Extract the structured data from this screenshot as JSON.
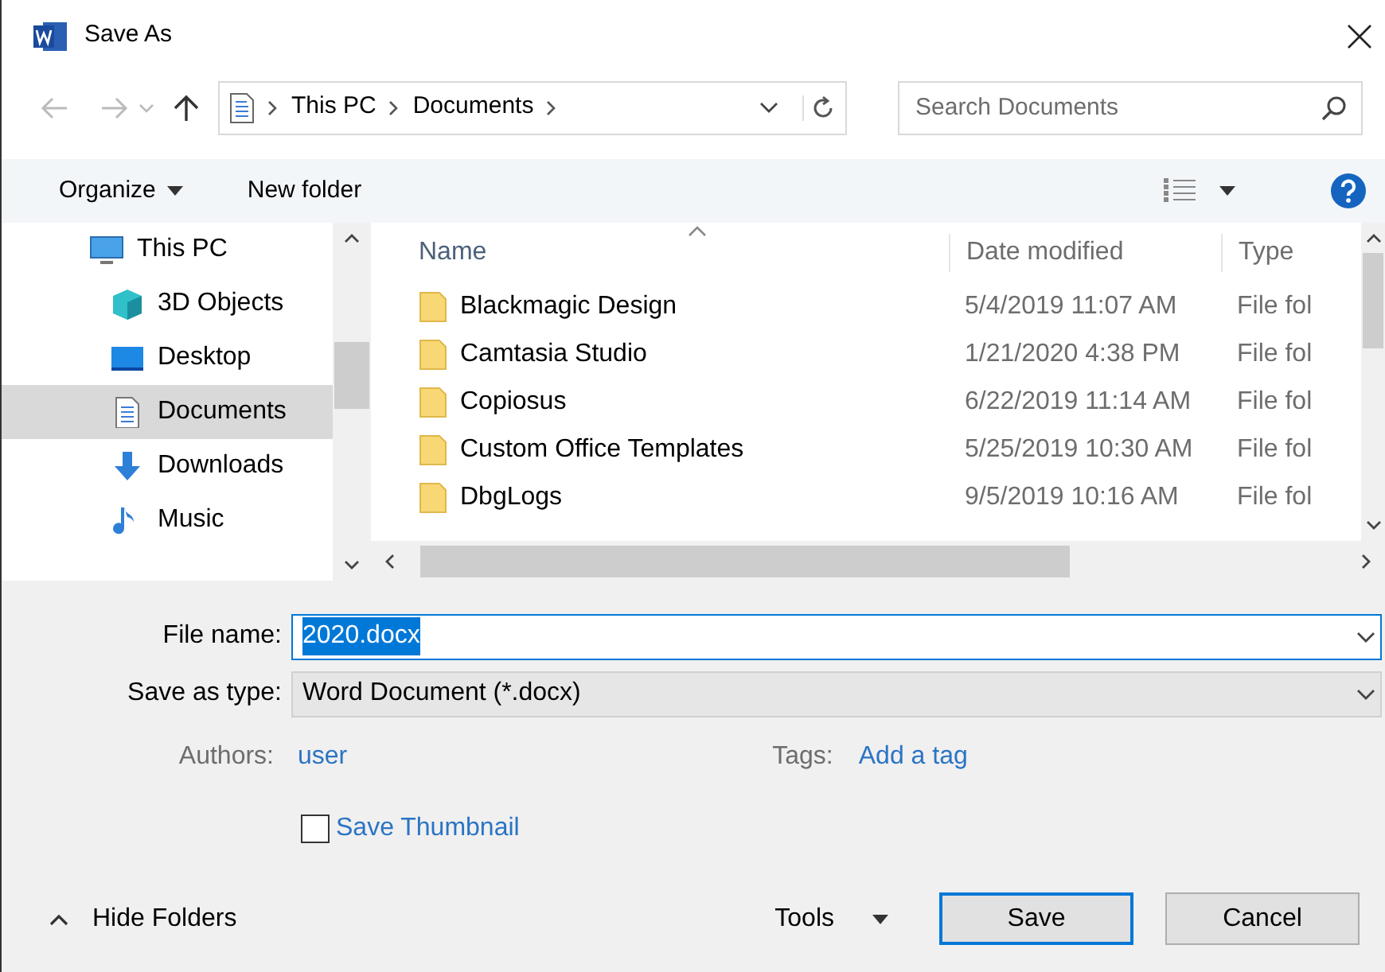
{
  "window": {
    "title": "Save As"
  },
  "address_bar": {
    "path": [
      "This PC",
      "Documents"
    ]
  },
  "search": {
    "placeholder": "Search Documents"
  },
  "toolbar": {
    "organize": "Organize",
    "new_folder": "New folder"
  },
  "sidebar": {
    "items": [
      {
        "label": "This PC",
        "kind": "pc",
        "selected": false,
        "children": [
          {
            "label": "3D Objects",
            "kind": "cube",
            "selected": false
          },
          {
            "label": "Desktop",
            "kind": "desktop",
            "selected": false
          },
          {
            "label": "Documents",
            "kind": "document",
            "selected": true
          },
          {
            "label": "Downloads",
            "kind": "download",
            "selected": false
          },
          {
            "label": "Music",
            "kind": "music",
            "selected": false
          }
        ]
      }
    ]
  },
  "file_list": {
    "columns": [
      "Name",
      "Date modified",
      "Type"
    ],
    "rows": [
      {
        "name": "Blackmagic Design",
        "date": "5/4/2019 11:07 AM",
        "type": "File fol"
      },
      {
        "name": "Camtasia Studio",
        "date": "1/21/2020 4:38 PM",
        "type": "File fol"
      },
      {
        "name": "Copiosus",
        "date": "6/22/2019 11:14 AM",
        "type": "File fol"
      },
      {
        "name": "Custom Office Templates",
        "date": "5/25/2019 10:30 AM",
        "type": "File fol"
      },
      {
        "name": "DbgLogs",
        "date": "9/5/2019 10:16 AM",
        "type": "File fol"
      }
    ]
  },
  "form": {
    "file_name": {
      "label": "File name:",
      "value": "2020.docx"
    },
    "save_as_type": {
      "label": "Save as type:",
      "value": "Word Document (*.docx)"
    },
    "authors": {
      "label": "Authors:",
      "value": "user"
    },
    "tags": {
      "label": "Tags:",
      "value": "Add a tag"
    },
    "save_thumbnail": {
      "label": "Save Thumbnail",
      "checked": false
    }
  },
  "footer": {
    "hide_folders": "Hide Folders",
    "tools": "Tools",
    "buttons": [
      {
        "label": "Save",
        "default": true
      },
      {
        "label": "Cancel",
        "default": false
      }
    ]
  }
}
